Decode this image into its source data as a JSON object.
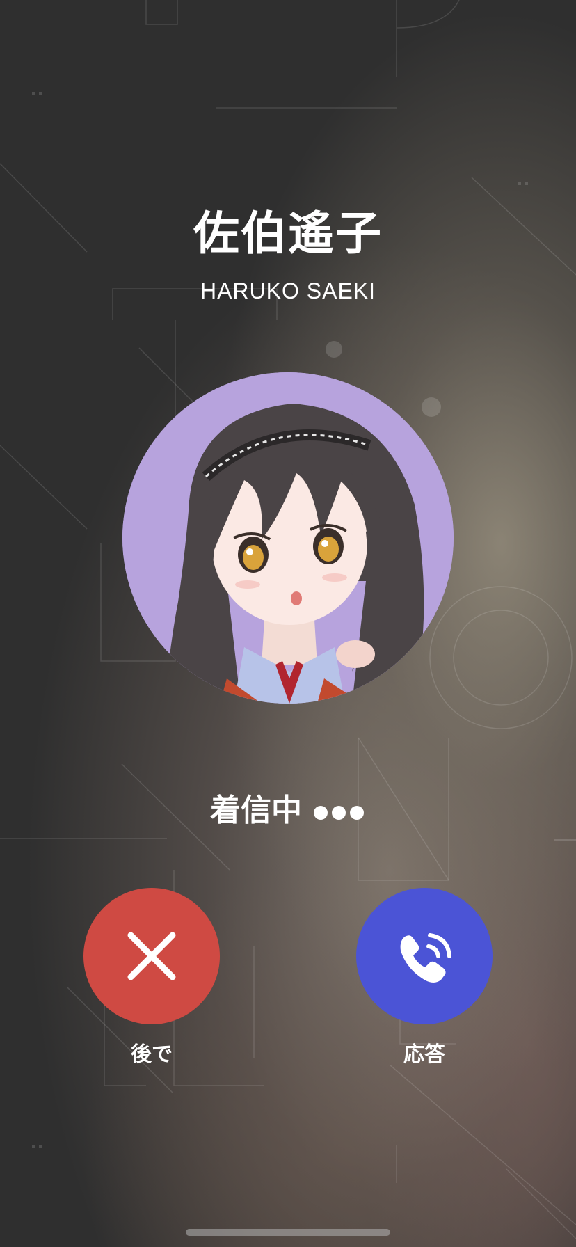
{
  "caller": {
    "name_jp": "佐伯遙子",
    "name_en": "HARUKO SAEKI",
    "avatar_icon": "anime-girl-portrait",
    "avatar_bg": "#b7a3dd"
  },
  "status": {
    "text": "着信中"
  },
  "actions": {
    "decline": {
      "label": "後で",
      "icon": "close-icon",
      "color": "#cf4a43"
    },
    "accept": {
      "label": "応答",
      "icon": "phone-ringing-icon",
      "color": "#4b54d6"
    }
  }
}
